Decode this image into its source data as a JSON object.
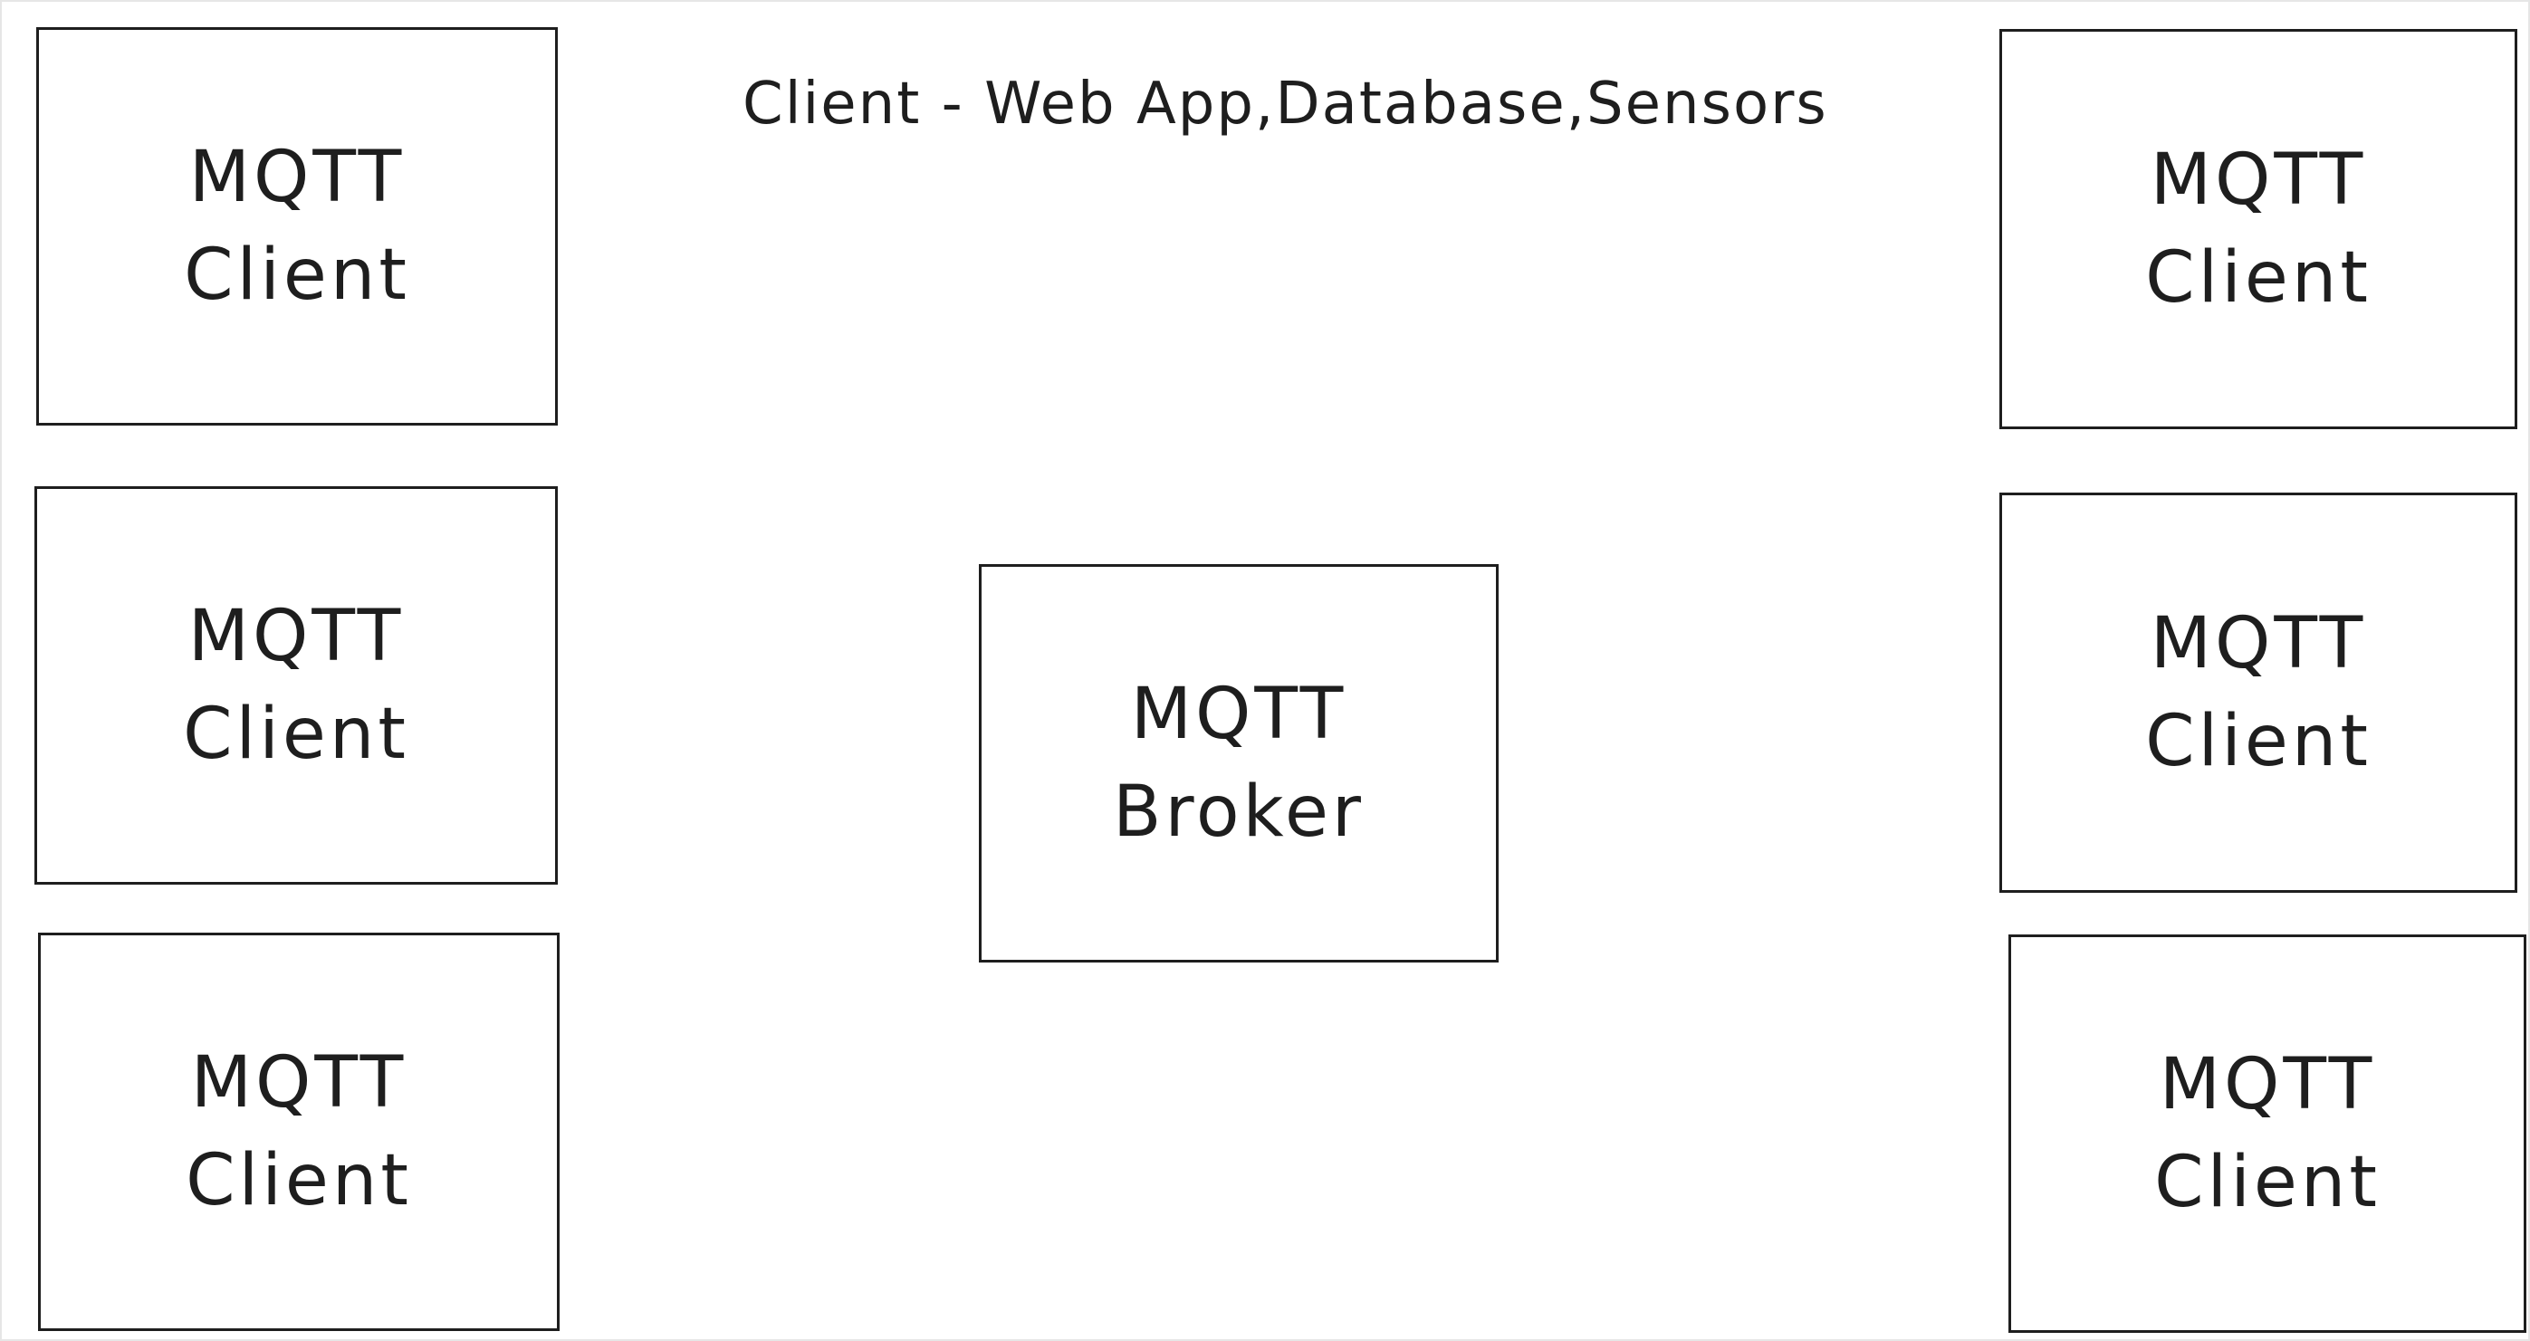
{
  "title": "Client - Web App,Database,Sensors",
  "broker": {
    "line1": "MQTT",
    "line2": "Broker"
  },
  "clients": [
    {
      "line1": "MQTT",
      "line2": "Client"
    },
    {
      "line1": "MQTT",
      "line2": "Client"
    },
    {
      "line1": "MQTT",
      "line2": "Client"
    },
    {
      "line1": "MQTT",
      "line2": "Client"
    },
    {
      "line1": "MQTT",
      "line2": "Client"
    },
    {
      "line1": "MQTT",
      "line2": "Client"
    }
  ],
  "colors": {
    "stroke": "#1e1e1e",
    "background": "#ffffff"
  }
}
